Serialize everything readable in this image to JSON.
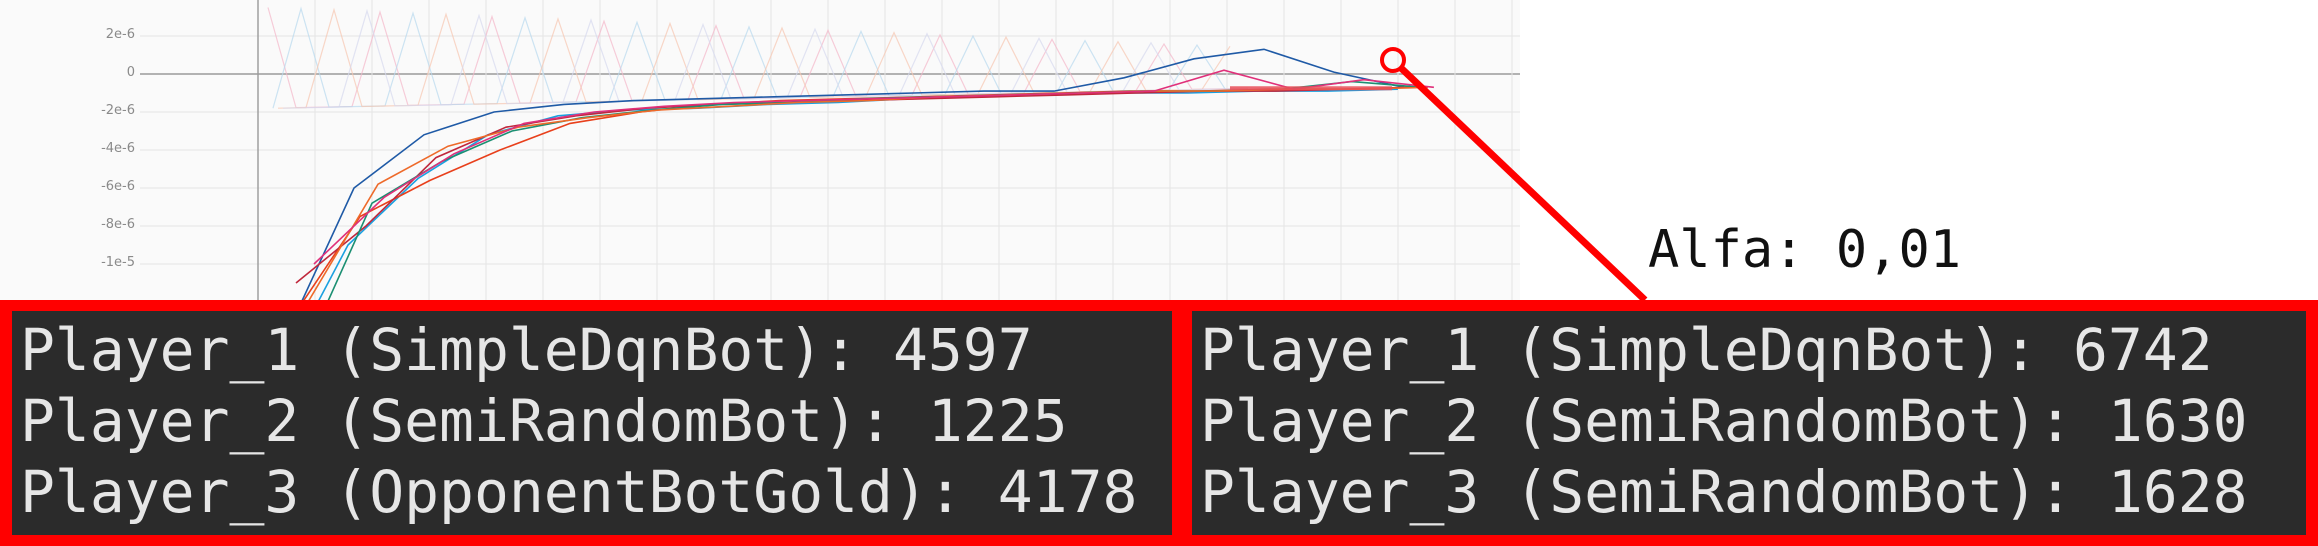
{
  "chart_data": {
    "type": "line",
    "title": "",
    "xlabel": "",
    "ylabel": "",
    "y_ticks": [
      "2e-6",
      "0",
      "-2e-6",
      "-4e-6",
      "-6e-6",
      "-8e-6",
      "-1e-5"
    ],
    "ylim": [
      -1.2e-05,
      3.8e-06
    ],
    "grid": true,
    "legend": "none",
    "series": [
      {
        "color": "#1aa0e0",
        "values": [
          -1.6e-05,
          -9e-06,
          -5.5e-06,
          -3.2e-06,
          -2.2e-06,
          -1.9e-06,
          -1.8e-06,
          -1.6e-06,
          -1.5e-06,
          -1.3e-06,
          -1.2e-06,
          -1.1e-06,
          -1e-06,
          -1e-06,
          -9e-07,
          -9e-07,
          -8e-07
        ]
      },
      {
        "color": "#1f5aa6",
        "values": [
          -1.4e-05,
          -6e-06,
          -3.2e-06,
          -2e-06,
          -1.6e-06,
          -1.4e-06,
          -1.3e-06,
          -1.2e-06,
          -1.1e-06,
          -1e-06,
          -9e-07,
          -9e-07,
          -2e-07,
          8e-07,
          1.3e-06,
          1e-07,
          -7e-07
        ]
      },
      {
        "color": "#e8401c",
        "values": [
          -1.3e-05,
          -7.5e-06,
          -5.6e-06,
          -4e-06,
          -2.6e-06,
          -2e-06,
          -1.6e-06,
          -1.4e-06,
          -1.3e-06,
          -1.2e-06,
          -1.1e-06,
          -1e-06,
          -9e-07,
          -9e-07,
          -8e-07,
          -8e-07,
          -7e-07
        ]
      },
      {
        "color": "#c0283c",
        "values": [
          -1.1e-05,
          -8e-06,
          -4.4e-06,
          -2.8e-06,
          -2.2e-06,
          -1.8e-06,
          -1.6e-06,
          -1.5e-06,
          -1.4e-06,
          -1.3e-06,
          -1.2e-06,
          -1.1e-06,
          -1e-06,
          -9e-07,
          -9e-07,
          -8e-07,
          -7e-07
        ]
      },
      {
        "color": "#1b8f72",
        "values": [
          -1.5e-05,
          -6.8e-06,
          -4.6e-06,
          -3e-06,
          -2.3e-06,
          -1.9e-06,
          -1.6e-06,
          -1.5e-06,
          -1.3e-06,
          -1.2e-06,
          -1.1e-06,
          -1e-06,
          -9e-07,
          -9e-07,
          -8e-07,
          -4e-07,
          -7e-07
        ]
      },
      {
        "color": "#ee6a2a",
        "values": [
          -1.2e-05,
          -5.8e-06,
          -3.8e-06,
          -2.8e-06,
          -2.3e-06,
          -1.9e-06,
          -1.7e-06,
          -1.5e-06,
          -1.4e-06,
          -1.2e-06,
          -1.1e-06,
          -1e-06,
          -9e-07,
          -9e-07,
          -8e-07,
          -8e-07,
          -7e-07
        ]
      },
      {
        "color": "#e0307a",
        "values": [
          -1e-05,
          -6.5e-06,
          -4.2e-06,
          -2.6e-06,
          -2e-06,
          -1.7e-06,
          -1.5e-06,
          -1.4e-06,
          -1.3e-06,
          -1.2e-06,
          -1.1e-06,
          -1e-06,
          -9e-07,
          2e-07,
          -8e-07,
          -3e-07,
          -7e-07
        ]
      }
    ],
    "x_count": 17
  },
  "annotation": {
    "label": "Alfa: 0,01"
  },
  "panels": {
    "left": {
      "lines": [
        "Player_1 (SimpleDqnBot): 4597",
        "Player_2 (SemiRandomBot): 1225",
        "Player_3 (OpponentBotGold): 4178"
      ]
    },
    "right": {
      "lines": [
        "Player_1 (SimpleDqnBot): 6742",
        "Player_2 (SemiRandomBot): 1630",
        "Player_3 (SemiRandomBot): 1628"
      ]
    }
  },
  "colors": {
    "highlight": "#ff0000",
    "terminal_bg": "#2b2b2b",
    "terminal_text": "#e6e6e6",
    "chart_bg": "#fafafa",
    "grid": "#e4e4e4"
  }
}
